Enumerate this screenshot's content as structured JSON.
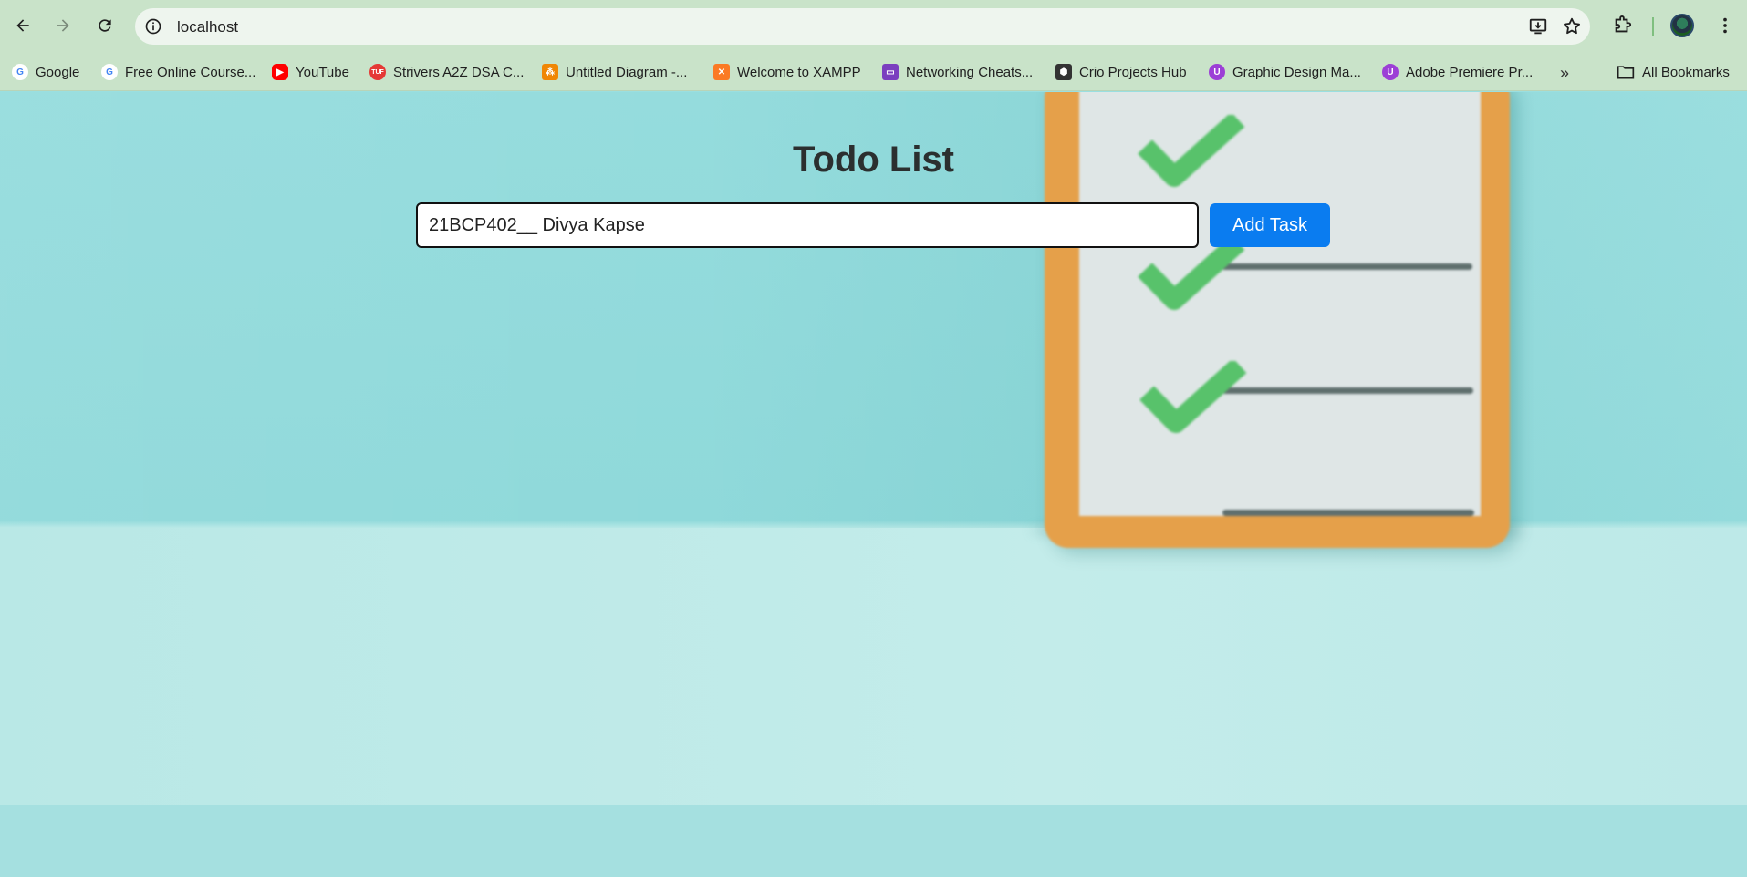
{
  "browser": {
    "url": "localhost",
    "bookmarks": [
      {
        "label": "Google",
        "icon": "google-icon",
        "color": "#4285f4"
      },
      {
        "label": "Free Online Course...",
        "icon": "google-icon",
        "color": "#4285f4"
      },
      {
        "label": "YouTube",
        "icon": "youtube-icon",
        "color": "#ff0000"
      },
      {
        "label": "Strivers A2Z DSA C...",
        "icon": "tuf-icon",
        "color": "#e53935"
      },
      {
        "label": "Untitled Diagram -...",
        "icon": "diagram-icon",
        "color": "#f08705"
      },
      {
        "label": "Welcome to XAMPP",
        "icon": "xampp-icon",
        "color": "#fb7a24"
      },
      {
        "label": "Networking Cheats...",
        "icon": "presentation-icon",
        "color": "#7b3fbf"
      },
      {
        "label": "Crio Projects Hub",
        "icon": "crio-icon",
        "color": "#333333"
      },
      {
        "label": "Graphic Design Ma...",
        "icon": "course-icon",
        "color": "#9c3fd6"
      },
      {
        "label": "Adobe Premiere Pr...",
        "icon": "course-icon",
        "color": "#9c3fd6"
      }
    ],
    "all_bookmarks_label": "All Bookmarks"
  },
  "app": {
    "title": "Todo List",
    "input_value": "21BCP402__ Divya Kapse",
    "add_button_label": "Add Task"
  }
}
